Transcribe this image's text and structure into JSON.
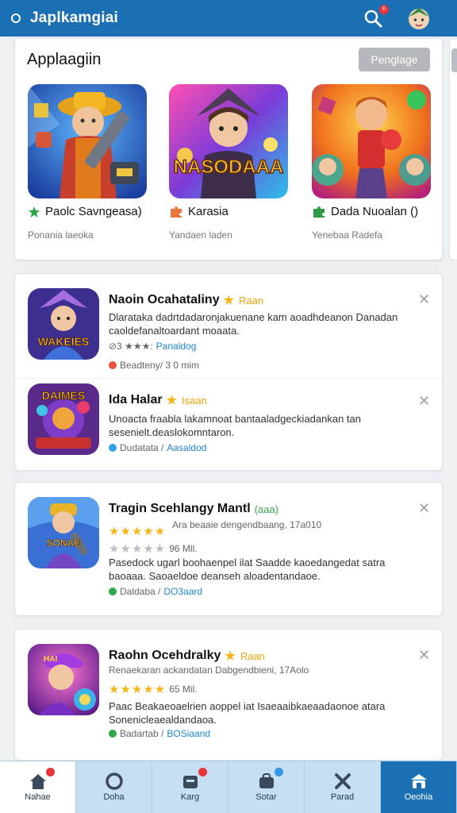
{
  "header": {
    "title": "Japlkamgiai",
    "notification_count": "6"
  },
  "featured": {
    "title": "Applaagiin",
    "button_label": "Penglage",
    "items": [
      {
        "name": "Paolc Savngeasa)",
        "sub": "Ponania laeoka",
        "icon": "star-icon",
        "color": "#29a744"
      },
      {
        "name": "Karasia",
        "sub": "Yandaen laden",
        "icon": "puzzle-icon",
        "color": "#e9763b"
      },
      {
        "name": "Dada Nuoalan ()",
        "sub": "Yenebaa Radefa",
        "icon": "puzzle-icon",
        "color": "#2d9a46"
      }
    ],
    "thumb_texts": [
      "",
      "NASODAAA",
      ""
    ]
  },
  "list": [
    {
      "title": "Naoin Ocahataliny",
      "badge": "Raan",
      "desc": "Dlarataka dadrtdadaronjakuenane kam aoadhdeanon Danadan caoldefanaltoardant moaata.",
      "meta_pre": "⊘3 ★★★:",
      "meta_link": "Panaldog",
      "extra": "Beadteny/ 3 0 mim",
      "icon_text": "WAKEIES"
    },
    {
      "title": "Ida Halar",
      "badge": "Isaan",
      "desc": "Unoacta fraabla lakamnoat bantaaladgeckiadankan tan sesenielt.deaslokomntaron.",
      "meta_pre": "Dudatata /",
      "meta_link": "Aasaldod",
      "icon_text": "DAIMES"
    },
    {
      "title": "Tragin Scehlangy Mantl",
      "badge": "(aaa)",
      "sub": "Ara beaaie dengendbaang, 17a010",
      "rating": "★★★★★",
      "size": "96 Mll.",
      "desc": "Pasedock ugarl boohaenpel ilat Saadde kaoedangedat satra baoaaa. Saoaeldoe deanseh aloadentandaoe.",
      "meta_pre": "Daldaba /",
      "meta_link": "DO3aard",
      "icon_text": "SONAE"
    },
    {
      "title": "Raohn Ocehdralky",
      "badge": "Raan",
      "sub": "Renaekaran ackandatan Dabgendbieni, 17Aolo",
      "rating": "★★★★★",
      "size": "65 Mil.",
      "desc": "Paac Beakaeoaelrien aoppel iat Isaeaaibkaeaadaonoe atara Sonenicleaealdandaoa.",
      "meta_pre": "Badartab /",
      "meta_link": "BOSiaand",
      "icon_text": "HAI"
    }
  ],
  "tabs": [
    {
      "label": "Nahae",
      "icon": "home-icon"
    },
    {
      "label": "Doha",
      "icon": "circle-icon"
    },
    {
      "label": "Karg",
      "icon": "bag-icon"
    },
    {
      "label": "Sotar",
      "icon": "shop-icon"
    },
    {
      "label": "Parad",
      "icon": "tools-icon"
    },
    {
      "label": "Oeohia",
      "icon": "profile-icon"
    }
  ],
  "colors": {
    "primary": "#1a70b3",
    "tabbar": "#c6dff3",
    "star": "#f6b514",
    "link": "#1f87d6",
    "badge": "#e8333a"
  }
}
